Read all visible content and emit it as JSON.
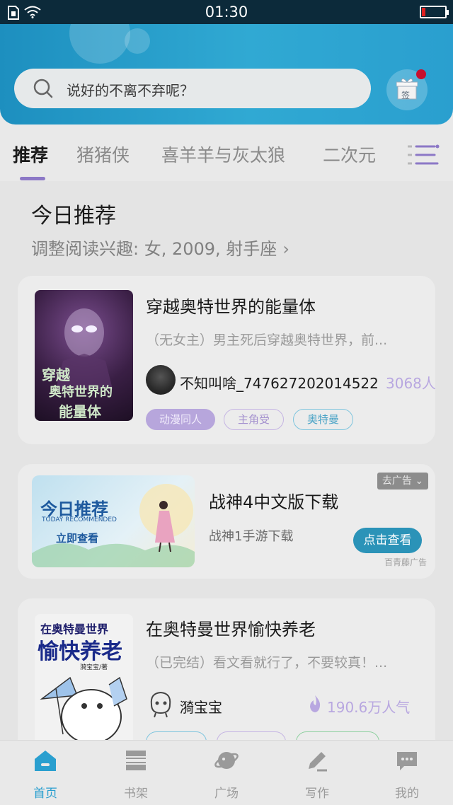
{
  "status_bar": {
    "time": "01:30"
  },
  "search": {
    "placeholder": "说好的不离不弃呢？"
  },
  "gift": {
    "label": "签"
  },
  "tabs": [
    {
      "label": "推荐"
    },
    {
      "label": "猪猪侠"
    },
    {
      "label": "喜羊羊与灰太狼"
    },
    {
      "label": "二次元"
    }
  ],
  "section": {
    "title": "今日推荐",
    "subtitle": "调整阅读兴趣: 女, 2009, 射手座"
  },
  "books": [
    {
      "title": "穿越奥特世界的能量体",
      "desc": "（无女主）男主死后穿越奥特世界，前...",
      "author": "不知叫啥_747627202014522",
      "popularity": "3068人气",
      "cover_text": [
        "穿越",
        "奥特世界的",
        "能量体"
      ],
      "tags": [
        "动漫同人",
        "主角受",
        "奥特曼"
      ]
    },
    {
      "title": "在奥特曼世界愉快养老",
      "desc": "（已完结）看文看就行了，不要较真！...",
      "author": "漪宝宝",
      "popularity": "190.6万人气",
      "cover_text": [
        "在奥特曼世界",
        "愉快养老",
        "漪宝宝/著"
      ]
    }
  ],
  "ad": {
    "image_title": "今日推荐",
    "image_subtitle": "TODAY RECOMMENDED",
    "image_button": "立即查看",
    "close_label": "去广告",
    "title": "战神4中文版下载",
    "subtitle": "战神1手游下载",
    "button": "点击查看",
    "source": "百青藤广告"
  },
  "bottom_nav": [
    {
      "label": "首页",
      "icon": "home-icon"
    },
    {
      "label": "书架",
      "icon": "bookshelf-icon"
    },
    {
      "label": "广场",
      "icon": "planet-icon"
    },
    {
      "label": "写作",
      "icon": "pen-icon"
    },
    {
      "label": "我的",
      "icon": "chat-bubble-icon"
    }
  ],
  "colors": {
    "accent_purple": "#8c78c6",
    "header_blue": "#2a9fcf",
    "active_nav": "#2a9fcf"
  }
}
